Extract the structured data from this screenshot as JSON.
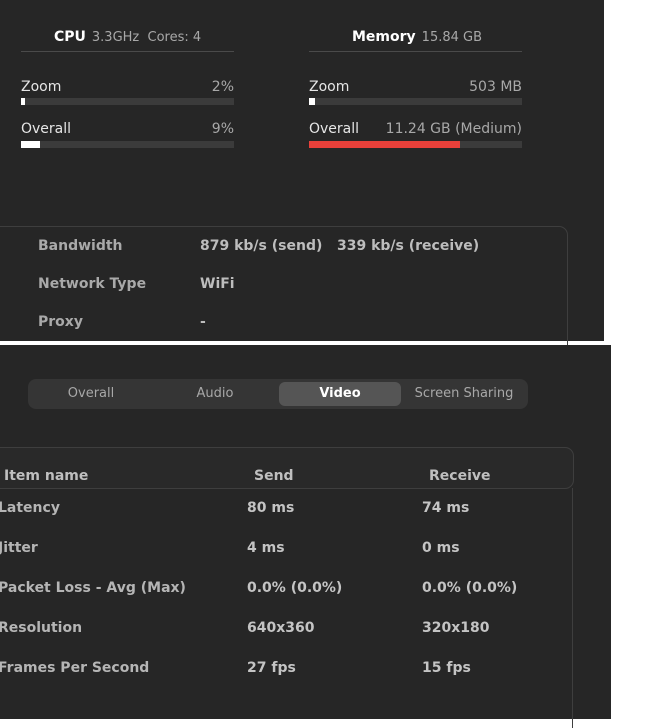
{
  "cpu": {
    "title": "CPU",
    "spec": "3.3GHz  Cores: 4",
    "zoom": {
      "label": "Zoom",
      "value": "2%",
      "fraction": 0.02
    },
    "overall": {
      "label": "Overall",
      "value": "9%",
      "fraction": 0.09
    }
  },
  "memory": {
    "title": "Memory",
    "spec": "15.84 GB",
    "zoom": {
      "label": "Zoom",
      "value": "503 MB",
      "fraction": 0.03
    },
    "overall": {
      "label": "Overall",
      "value": "11.24 GB (Medium)",
      "fraction": 0.71,
      "color": "#e8403a"
    }
  },
  "network": {
    "rows": [
      {
        "label": "Bandwidth",
        "value": "879 kb/s (send)   339 kb/s (receive)"
      },
      {
        "label": "Network Type",
        "value": "WiFi"
      },
      {
        "label": "Proxy",
        "value": "-"
      }
    ]
  },
  "tabs": {
    "items": [
      "Overall",
      "Audio",
      "Video",
      "Screen Sharing"
    ],
    "active": "Video"
  },
  "table": {
    "headers": [
      "Item name",
      "Send",
      "Receive"
    ],
    "rows": [
      [
        "Latency",
        "80 ms",
        "74 ms"
      ],
      [
        "Jitter",
        "4 ms",
        "0 ms"
      ],
      [
        "Packet Loss - Avg (Max)",
        "0.0% (0.0%)",
        "0.0% (0.0%)"
      ],
      [
        "Resolution",
        "640x360",
        "320x180"
      ],
      [
        "Frames Per Second",
        "27 fps",
        "15 fps"
      ]
    ]
  },
  "colors": {
    "background": "#262626",
    "accent_red": "#e8403a",
    "bar_track": "#3b3b3b"
  }
}
